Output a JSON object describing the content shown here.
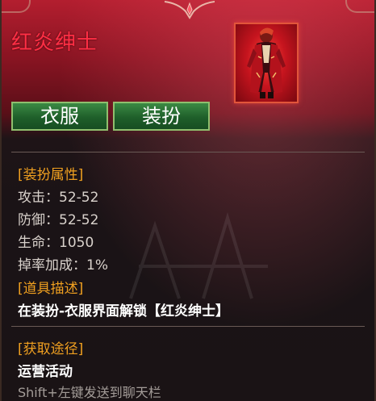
{
  "item": {
    "name": "红炎绅士",
    "portrait_icon": "red-gentleman-figure-icon",
    "name_color": "#ff2f45"
  },
  "tabs": [
    {
      "label": "衣服"
    },
    {
      "label": "装扮"
    }
  ],
  "attributes": {
    "heading": "[装扮属性]",
    "stats": [
      {
        "text": "攻击：52-52"
      },
      {
        "text": "防御：52-52"
      },
      {
        "text": "生命：1050"
      },
      {
        "text": "掉率加成：1%"
      }
    ]
  },
  "description": {
    "heading": "[道具描述]",
    "text": "在装扮-衣服界面解锁【红炎绅士】"
  },
  "acquire": {
    "heading": "[获取途径]",
    "text": "运营活动",
    "hint": "Shift+左键发送到聊天栏"
  },
  "colors": {
    "heading": "#f0a020",
    "tab_green": "#2f7a38",
    "panel_red": "#b31e2f"
  }
}
